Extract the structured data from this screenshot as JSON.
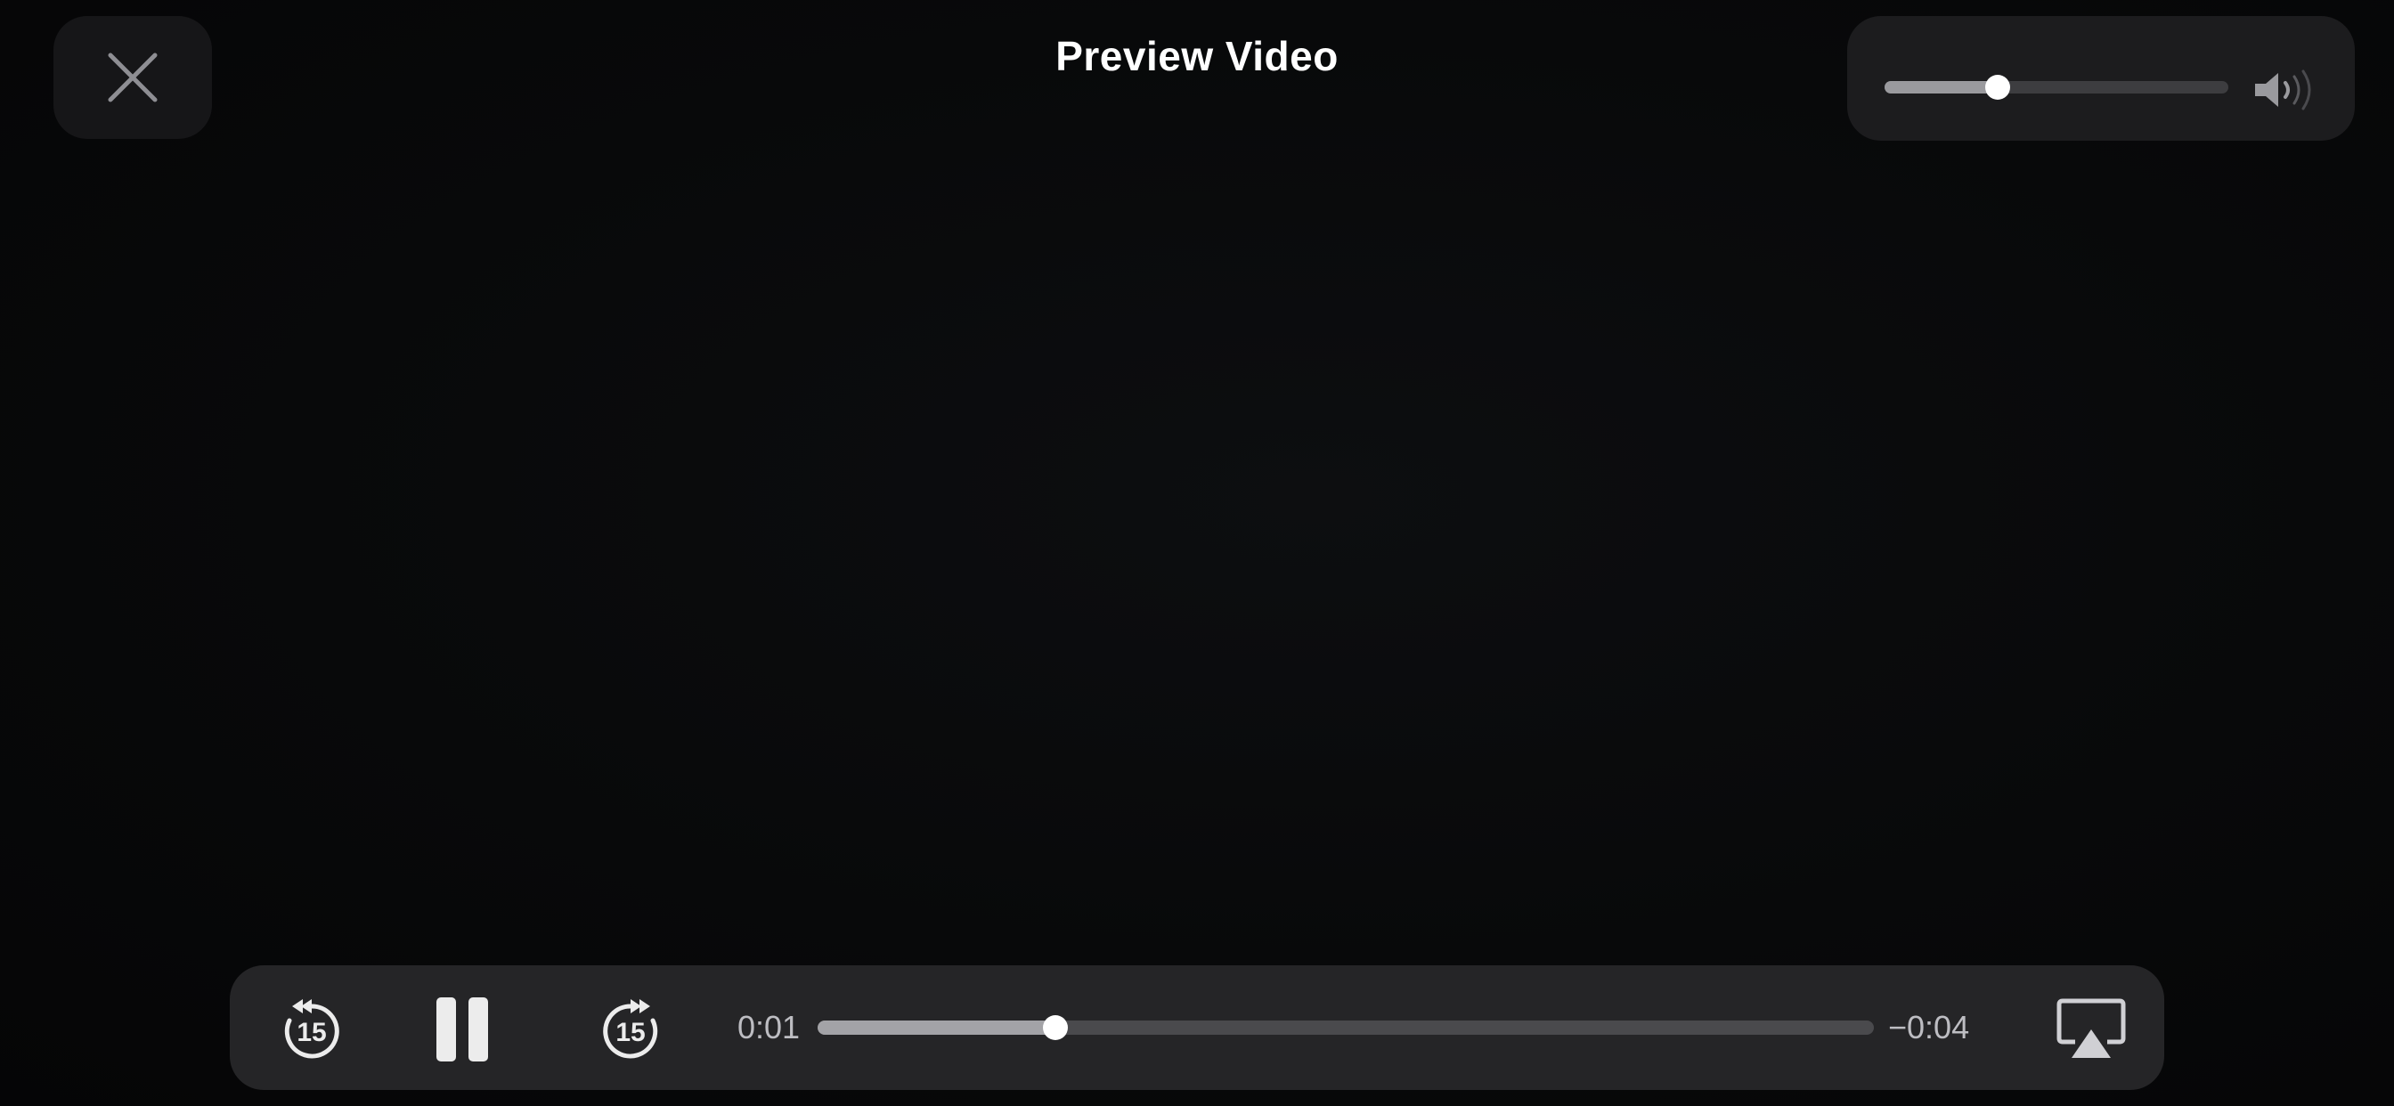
{
  "header": {
    "title": "Preview Video",
    "close_icon": "close-icon"
  },
  "volume": {
    "level": 0.33,
    "icon": "speaker-volume-icon"
  },
  "transport": {
    "skip_back_label": "15",
    "skip_back_icon": "skip-back-15-icon",
    "play_state": "playing",
    "pause_icon": "pause-icon",
    "skip_forward_label": "15",
    "skip_forward_icon": "skip-forward-15-icon",
    "time_elapsed": "0:01",
    "time_remaining": "−0:04",
    "progress": 0.225,
    "airplay_icon": "airplay-icon"
  },
  "colors": {
    "background": "#070708",
    "panel": "#252527",
    "accent": "#ffffff"
  }
}
